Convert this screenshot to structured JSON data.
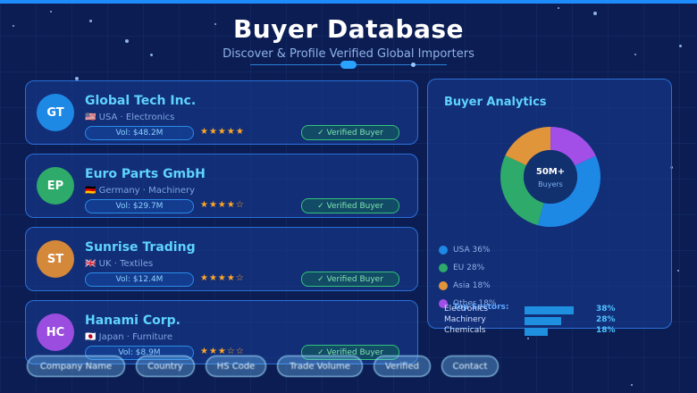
{
  "header": {
    "title": "Buyer Database",
    "subtitle": "Discover & Profile Verified Global Importers"
  },
  "buyers": [
    {
      "initials": "GT",
      "name": "Global Tech Inc.",
      "flag": "🇺🇸",
      "country": "USA",
      "sector": "Electronics",
      "volume": "Vol: $48.2M",
      "rating_stars": "★★★★★",
      "rating": 5,
      "badge": "✓ Verified Buyer",
      "avatar_color": "#1e88e5"
    },
    {
      "initials": "EP",
      "name": "Euro Parts GmbH",
      "flag": "🇩🇪",
      "country": "Germany",
      "sector": "Machinery",
      "volume": "Vol: $29.7M",
      "rating_stars": "★★★★☆",
      "rating": 4,
      "badge": "✓ Verified Buyer",
      "avatar_color": "#2eaa6a"
    },
    {
      "initials": "ST",
      "name": "Sunrise Trading",
      "flag": "🇬🇧",
      "country": "UK",
      "sector": "Textiles",
      "volume": "Vol: $12.4M",
      "rating_stars": "★★★★☆",
      "rating": 4,
      "badge": "✓ Verified Buyer",
      "avatar_color": "#d4883a"
    },
    {
      "initials": "HC",
      "name": "Hanami Corp.",
      "flag": "🇯🇵",
      "country": "Japan",
      "sector": "Furniture",
      "volume": "Vol: $8.9M",
      "rating_stars": "★★★☆☆",
      "rating": 3,
      "badge": "✓ Verified Buyer",
      "avatar_color": "#9b4de0"
    }
  ],
  "analytics": {
    "title": "Buyer Analytics",
    "center_value": "50M+",
    "center_label": "Buyers",
    "regions": [
      {
        "label": "USA 36%",
        "value": 36,
        "color": "#1e88e5"
      },
      {
        "label": "EU 28%",
        "value": 28,
        "color": "#2eaa6a"
      },
      {
        "label": "Asia 18%",
        "value": 18,
        "color": "#e0953a"
      },
      {
        "label": "Other 18%",
        "value": 18,
        "color": "#a14fe6"
      }
    ],
    "top_sectors_label": "Top Sectors:",
    "sectors": [
      {
        "label": "Electronics",
        "value": 38,
        "pct": "38%"
      },
      {
        "label": "Machinery",
        "value": 28,
        "pct": "28%"
      },
      {
        "label": "Chemicals",
        "value": 18,
        "pct": "18%"
      }
    ]
  },
  "chips": [
    "Company Name",
    "Country",
    "HS Code",
    "Trade Volume",
    "Verified",
    "Contact"
  ]
}
